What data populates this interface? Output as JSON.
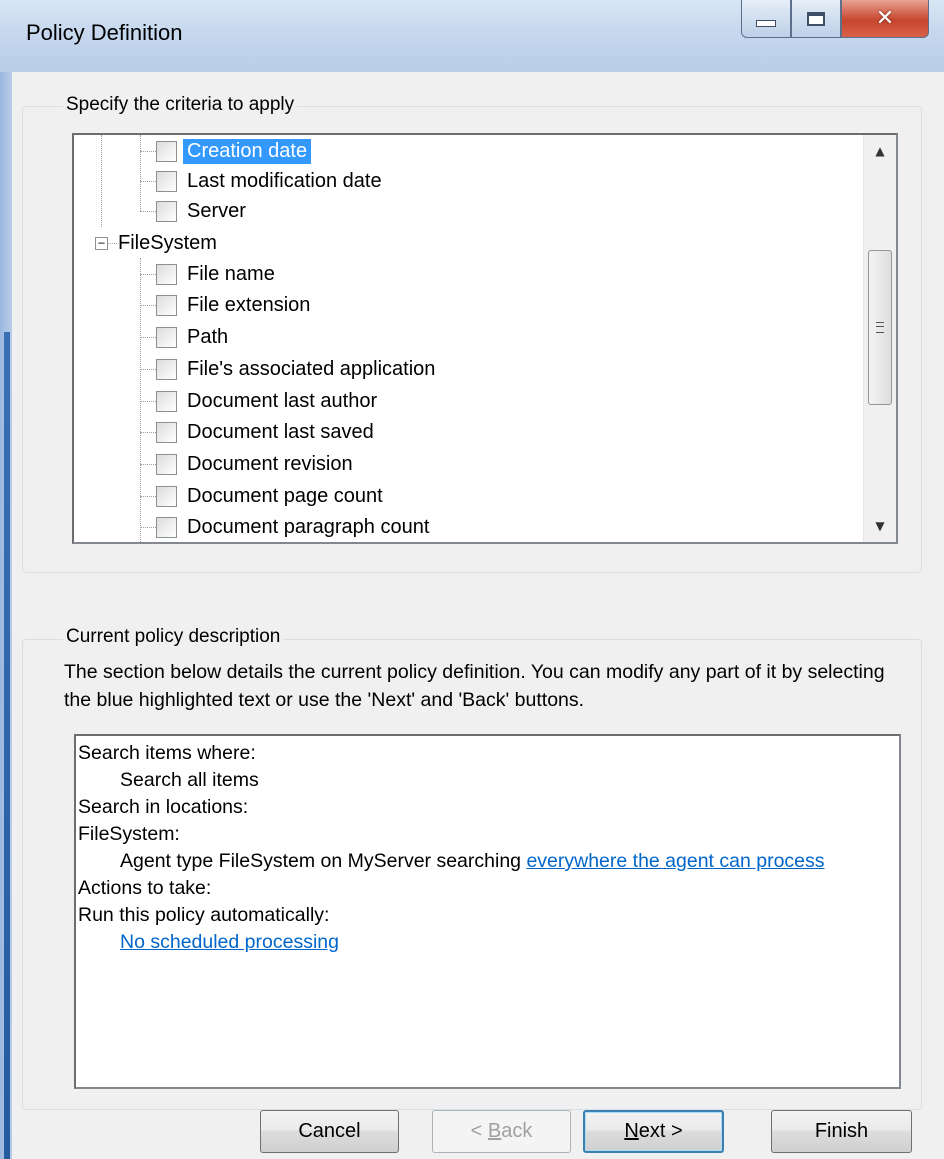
{
  "window": {
    "title": "Policy Definition",
    "controls": {
      "minimize": "minimize-icon",
      "maximize": "maximize-icon",
      "close": "close-icon"
    }
  },
  "criteria": {
    "group_label": "Specify the criteria to apply",
    "tree": [
      {
        "label": "Creation date",
        "checked": false,
        "selected": true
      },
      {
        "label": "Last modification date",
        "checked": false,
        "selected": false
      },
      {
        "label": "Server",
        "checked": false,
        "selected": false
      },
      {
        "label": "FileSystem",
        "parent": true,
        "expanded": true
      },
      {
        "label": "File name",
        "checked": false,
        "selected": false
      },
      {
        "label": "File extension",
        "checked": false,
        "selected": false
      },
      {
        "label": "Path",
        "checked": false,
        "selected": false
      },
      {
        "label": "File's associated application",
        "checked": false,
        "selected": false
      },
      {
        "label": "Document last author",
        "checked": false,
        "selected": false
      },
      {
        "label": "Document last saved",
        "checked": false,
        "selected": false
      },
      {
        "label": "Document revision",
        "checked": false,
        "selected": false
      },
      {
        "label": "Document page count",
        "checked": false,
        "selected": false
      },
      {
        "label": "Document paragraph count",
        "checked": false,
        "selected": false
      }
    ]
  },
  "description": {
    "group_label": "Current policy description",
    "intro": "The section below details the current policy definition. You can modify any part of it by selecting the blue highlighted text or use the 'Next' and 'Back' buttons.",
    "lines": {
      "search_items_where": "Search items where:",
      "search_all_items": "Search all items",
      "search_in_locations": "Search in locations:",
      "filesystem": "FileSystem:",
      "agent_prefix": "Agent type FileSystem on MyServer searching ",
      "agent_link": "everywhere the agent can process",
      "actions_to_take": "Actions to take:",
      "run_automatically": "Run this policy automatically:",
      "schedule_link": "No scheduled processing"
    },
    "colors": {
      "link": "#0066cc",
      "selection": "#3399ff"
    }
  },
  "buttons": {
    "cancel": "Cancel",
    "back_mnemonic": "B",
    "back_rest": "ack",
    "back_prefix": "< ",
    "next_mnemonic": "N",
    "next_rest": "ext >",
    "finish": "Finish"
  }
}
